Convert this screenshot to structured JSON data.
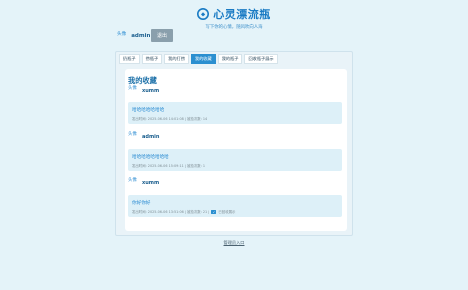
{
  "app": {
    "title": "心灵漂流瓶",
    "subtitle": "写下你的心情，随风吹向人海",
    "brand_color": "#1a7bc4",
    "accent_color": "#2b8fd0"
  },
  "user": {
    "avatar_label": "头像",
    "name": "admin",
    "logout_label": "退出"
  },
  "tabs": [
    {
      "label": "扔瓶子",
      "active": false
    },
    {
      "label": "捞瓶子",
      "active": false
    },
    {
      "label": "我的打捞",
      "active": false
    },
    {
      "label": "我的收藏",
      "active": true
    },
    {
      "label": "我的瓶子",
      "active": false
    },
    {
      "label": "回收瓶子展示",
      "active": false
    }
  ],
  "favorites": {
    "title": "我的收藏",
    "posts": [
      {
        "avatar_label": "头像",
        "user": "xumm",
        "text": "哈哈哈哈哈哈哈",
        "meta": "发出时间: 2025-06-06 14:01:08 | 被捡次数: 14",
        "meta_extra": ""
      },
      {
        "avatar_label": "头像",
        "user": "admin",
        "text": "哈哈哈哈哈哈哈哈",
        "meta": "发出时间: 2025-06-06 15:09:11 | 被捡次数: 1",
        "meta_extra": ""
      },
      {
        "avatar_label": "头像",
        "user": "xumm",
        "text": "你好你好",
        "meta": "发出时间: 2025-06-06 13:51:06 | 被捡次数: 21 |",
        "meta_extra": "已回收展示"
      }
    ]
  },
  "footer": {
    "admin_link": "管理员入口"
  }
}
